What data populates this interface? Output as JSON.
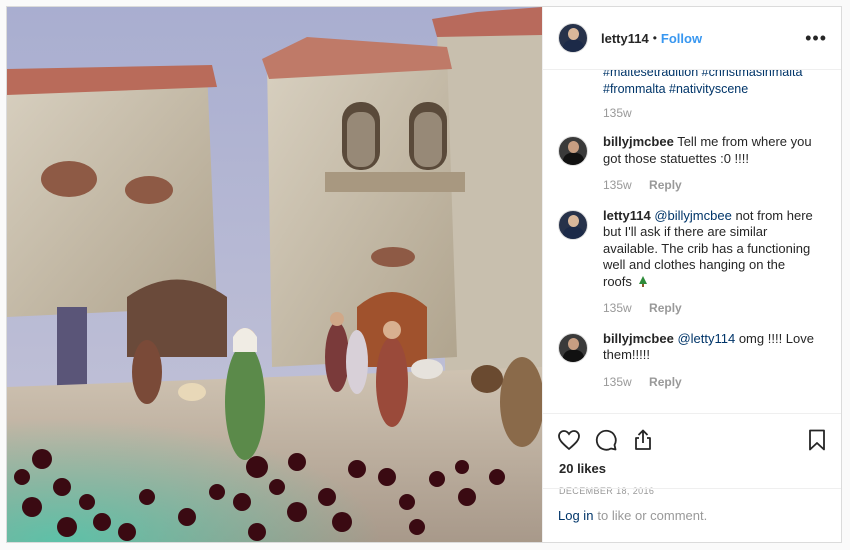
{
  "header": {
    "username": "letty114",
    "separator": "•",
    "follow_label": "Follow",
    "more_label": "•••"
  },
  "caption": {
    "tail_line_1": "#maltesetradition #christmasinmalta",
    "tail_line_2": "#frommalta #nativityscene",
    "time": "135w"
  },
  "comments": [
    {
      "user": "billyjmcbee",
      "mention": "",
      "text": "Tell me from where you got those statuettes :0 !!!!",
      "time": "135w",
      "reply_label": "Reply"
    },
    {
      "user": "letty114",
      "mention": "@billyjmcbee",
      "text": "not from here but I'll ask if there are similar available. The crib has a functioning well and clothes hanging on the roofs",
      "time": "135w",
      "reply_label": "Reply",
      "emoji": "christmas-tree-icon"
    },
    {
      "user": "billyjmcbee",
      "mention": "@letty114",
      "text": "omg !!!! Love them!!!!!",
      "time": "135w",
      "reply_label": "Reply"
    }
  ],
  "actions": {
    "like_icon": "heart-icon",
    "comment_icon": "comment-icon",
    "share_icon": "share-icon",
    "save_icon": "bookmark-icon"
  },
  "likes_text": "20 likes",
  "date_text": "DECEMBER 18, 2016",
  "login": {
    "link_label": "Log in",
    "suffix": "to like or comment."
  },
  "colors": {
    "link_blue": "#3897f0",
    "hashtag_navy": "#003569",
    "muted_gray": "#999999",
    "border": "#dbdbdb"
  }
}
